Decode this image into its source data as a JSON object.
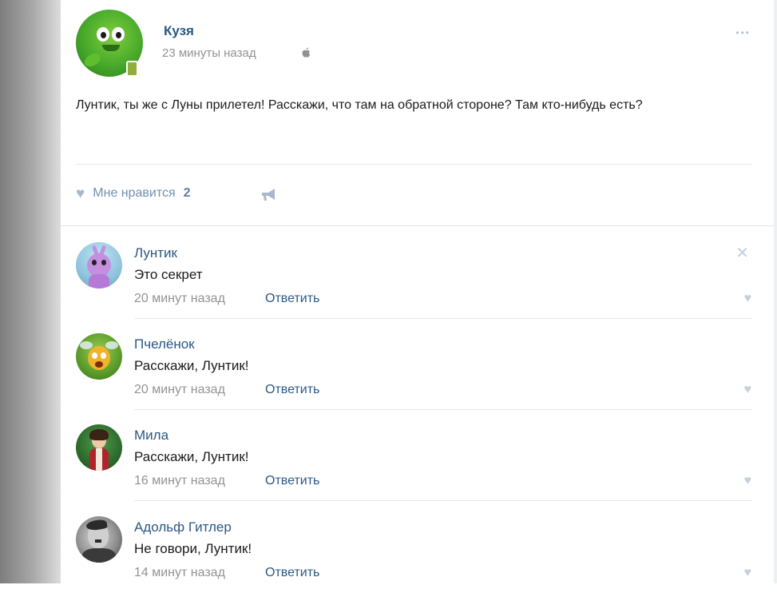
{
  "post": {
    "author": "Кузя",
    "time": "23 минуты назад",
    "platform_icon": "apple-icon",
    "text": "Лунтик, ты же с Луны прилетел! Расскажи, что там на обратной стороне? Там кто-нибудь есть?",
    "like_label": "Мне нравится",
    "like_count": "2"
  },
  "comments": [
    {
      "author": "Лунтик",
      "text": "Это секрет",
      "time": "20 минут назад",
      "reply": "Ответить"
    },
    {
      "author": "Пчелёнок",
      "text": "Расскажи, Лунтик!",
      "time": "20 минут назад",
      "reply": "Ответить"
    },
    {
      "author": "Мила",
      "text": "Расскажи, Лунтик!",
      "time": "16 минут назад",
      "reply": "Ответить"
    },
    {
      "author": "Адольф Гитлер",
      "text": "Не говори, Лунтик!",
      "time": "14 минут назад",
      "reply": "Ответить"
    }
  ],
  "colors": {
    "link": "#2a5885",
    "muted": "#939393",
    "text": "#1b1b1b",
    "icon_gray": "#c5d0db"
  }
}
